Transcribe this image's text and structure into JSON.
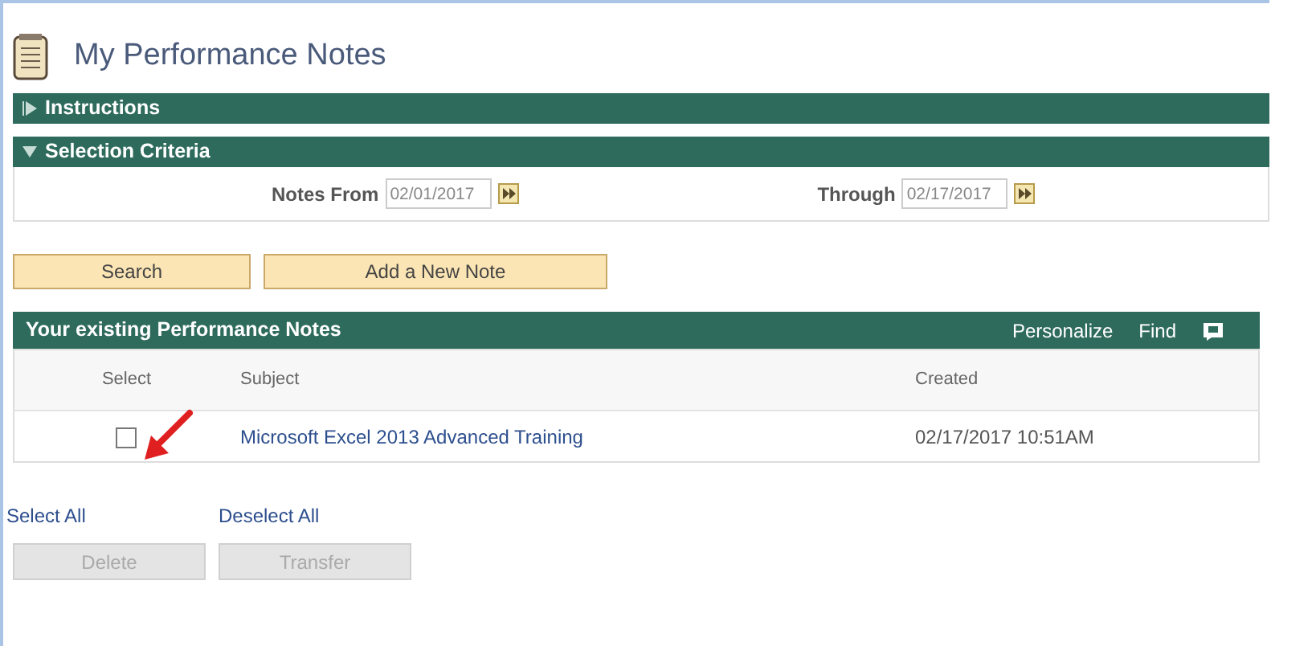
{
  "page_title": "My Performance Notes",
  "sections": [
    {
      "title": "Instructions",
      "expanded": false
    },
    {
      "title": "Selection Criteria",
      "expanded": true
    }
  ],
  "criteria": [
    {
      "label": "Notes From",
      "value": "02/01/2017"
    },
    {
      "label": "Through",
      "value": "02/17/2017"
    }
  ],
  "actions": [
    {
      "label": "Search"
    },
    {
      "label": "Add a New Note"
    }
  ],
  "grid": {
    "title": "Your existing Performance Notes",
    "tools": [
      "Personalize",
      "Find"
    ],
    "columns": [
      "Select",
      "Subject",
      "Created"
    ],
    "rows": [
      {
        "checked": false,
        "subject": "Microsoft Excel 2013 Advanced Training",
        "created": "02/17/2017 10:51AM"
      }
    ]
  },
  "links": [
    "Select All",
    "Deselect All"
  ],
  "bottom_buttons": [
    {
      "label": "Delete",
      "disabled": true
    },
    {
      "label": "Transfer",
      "disabled": true
    }
  ]
}
